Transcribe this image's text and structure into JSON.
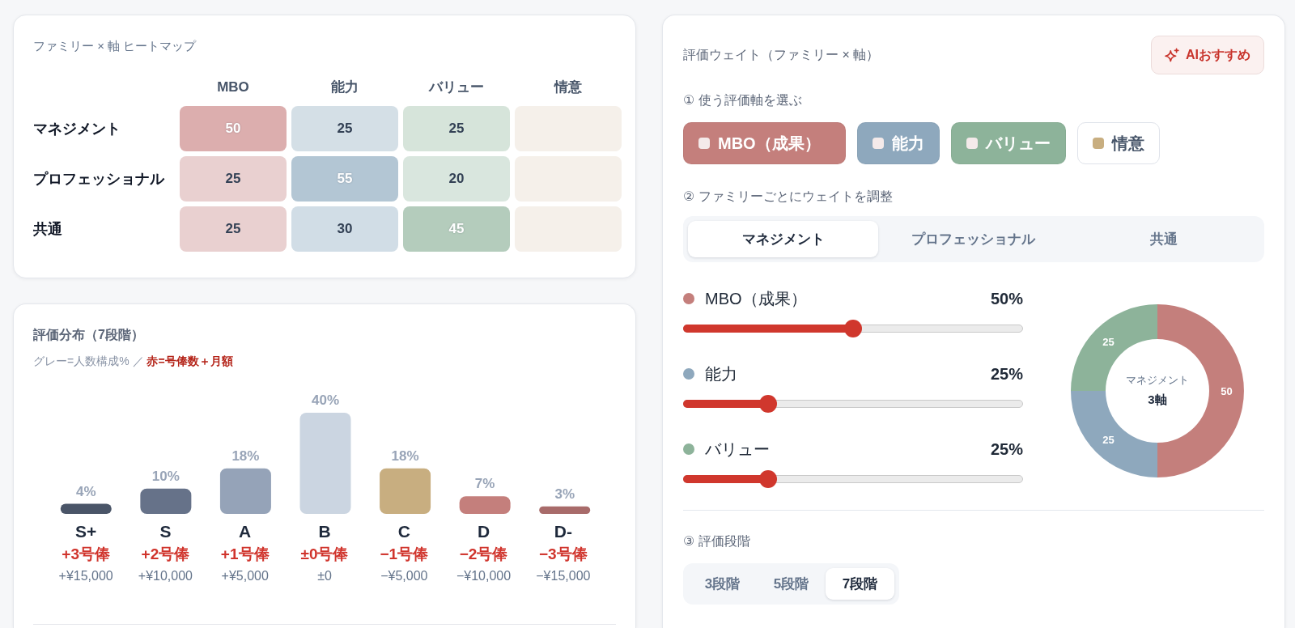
{
  "heatmap": {
    "title": "ファミリー × 軸 ヒートマップ",
    "columns": [
      "MBO",
      "能力",
      "バリュー",
      "情意"
    ],
    "rows": [
      {
        "label": "マネジメント",
        "cells": [
          {
            "value": "50",
            "color": "#dcaeae",
            "highlight": true
          },
          {
            "value": "25",
            "color": "#d4dfe6",
            "highlight": false
          },
          {
            "value": "25",
            "color": "#d6e4da",
            "highlight": false
          },
          {
            "color": "#f5f0ea"
          }
        ]
      },
      {
        "label": "プロフェッショナル",
        "cells": [
          {
            "value": "25",
            "color": "#e9d0d0",
            "highlight": false
          },
          {
            "value": "55",
            "color": "#b3c6d4",
            "highlight": true
          },
          {
            "value": "20",
            "color": "#d9e6de",
            "highlight": false
          },
          {
            "color": "#f5f0ea"
          }
        ]
      },
      {
        "label": "共通",
        "cells": [
          {
            "value": "25",
            "color": "#e9d0d0",
            "highlight": false
          },
          {
            "value": "30",
            "color": "#d1dde6",
            "highlight": false
          },
          {
            "value": "45",
            "color": "#b4ccbc",
            "highlight": true
          },
          {
            "color": "#f5f0ea"
          }
        ]
      }
    ]
  },
  "distribution": {
    "title": "評価分布（7段階）",
    "legend": "グレー=人数構成% ／ **赤=号俸数＋月額**",
    "chart_data": {
      "type": "bar",
      "categories": [
        "S+",
        "S",
        "A",
        "B",
        "C",
        "D",
        "D-"
      ],
      "values": [
        4,
        10,
        18,
        40,
        18,
        7,
        3
      ],
      "value_labels": [
        "4%",
        "10%",
        "18%",
        "40%",
        "18%",
        "7%",
        "3%"
      ]
    },
    "grades": [
      {
        "color": "#4a5568",
        "steps": "+3号俸",
        "amount": "+¥15,000"
      },
      {
        "color": "#667289",
        "steps": "+2号俸",
        "amount": "+¥10,000"
      },
      {
        "color": "#95a3b8",
        "steps": "+1号俸",
        "amount": "+¥5,000"
      },
      {
        "color": "#cbd5e1",
        "steps": "±0号俸",
        "amount": "±0"
      },
      {
        "color": "#c8ae80",
        "steps": "−1号俸",
        "amount": "−¥5,000"
      },
      {
        "color": "#c47f7c",
        "steps": "−2号俸",
        "amount": "−¥10,000"
      },
      {
        "color": "#a86b6a",
        "steps": "−3号俸",
        "amount": "−¥15,000"
      }
    ]
  },
  "weights": {
    "title": "評価ウェイト（ファミリー × 軸）",
    "ai_button": "AIおすすめ",
    "axis_prompt": "① 使う評価軸を選ぶ",
    "axes": [
      {
        "label": "MBO（成果）",
        "color": "#c47f7c",
        "selected": true
      },
      {
        "label": "能力",
        "color": "#8ea8bd",
        "selected": true
      },
      {
        "label": "バリュー",
        "color": "#8db39a",
        "selected": true
      },
      {
        "label": "情意",
        "color": "#c8ae80",
        "selected": false
      }
    ],
    "weight_prompt": "② ファミリーごとにウェイトを調整",
    "family_tabs": [
      {
        "label": "マネジメント",
        "selected": true
      },
      {
        "label": "プロフェッショナル",
        "selected": false
      },
      {
        "label": "共通",
        "selected": false
      }
    ],
    "sliders": [
      {
        "label": "MBO（成果）",
        "color": "#c47f7c",
        "level": 0.5,
        "reading": "50%"
      },
      {
        "label": "能力",
        "color": "#8ea8bd",
        "level": 0.25,
        "reading": "25%"
      },
      {
        "label": "バリュー",
        "color": "#8db39a",
        "level": 0.25,
        "reading": "25%"
      }
    ],
    "donut": {
      "center_label": "マネジメント",
      "center_value": "3軸",
      "chart_data": {
        "type": "donut",
        "values": [
          50,
          25,
          25
        ],
        "data_labels": true
      }
    },
    "scale_prompt": "③ 評価段階",
    "scale_tabs": [
      {
        "label": "3段階",
        "selected": false
      },
      {
        "label": "5段階",
        "selected": false
      },
      {
        "label": "7段階",
        "selected": true
      }
    ]
  }
}
